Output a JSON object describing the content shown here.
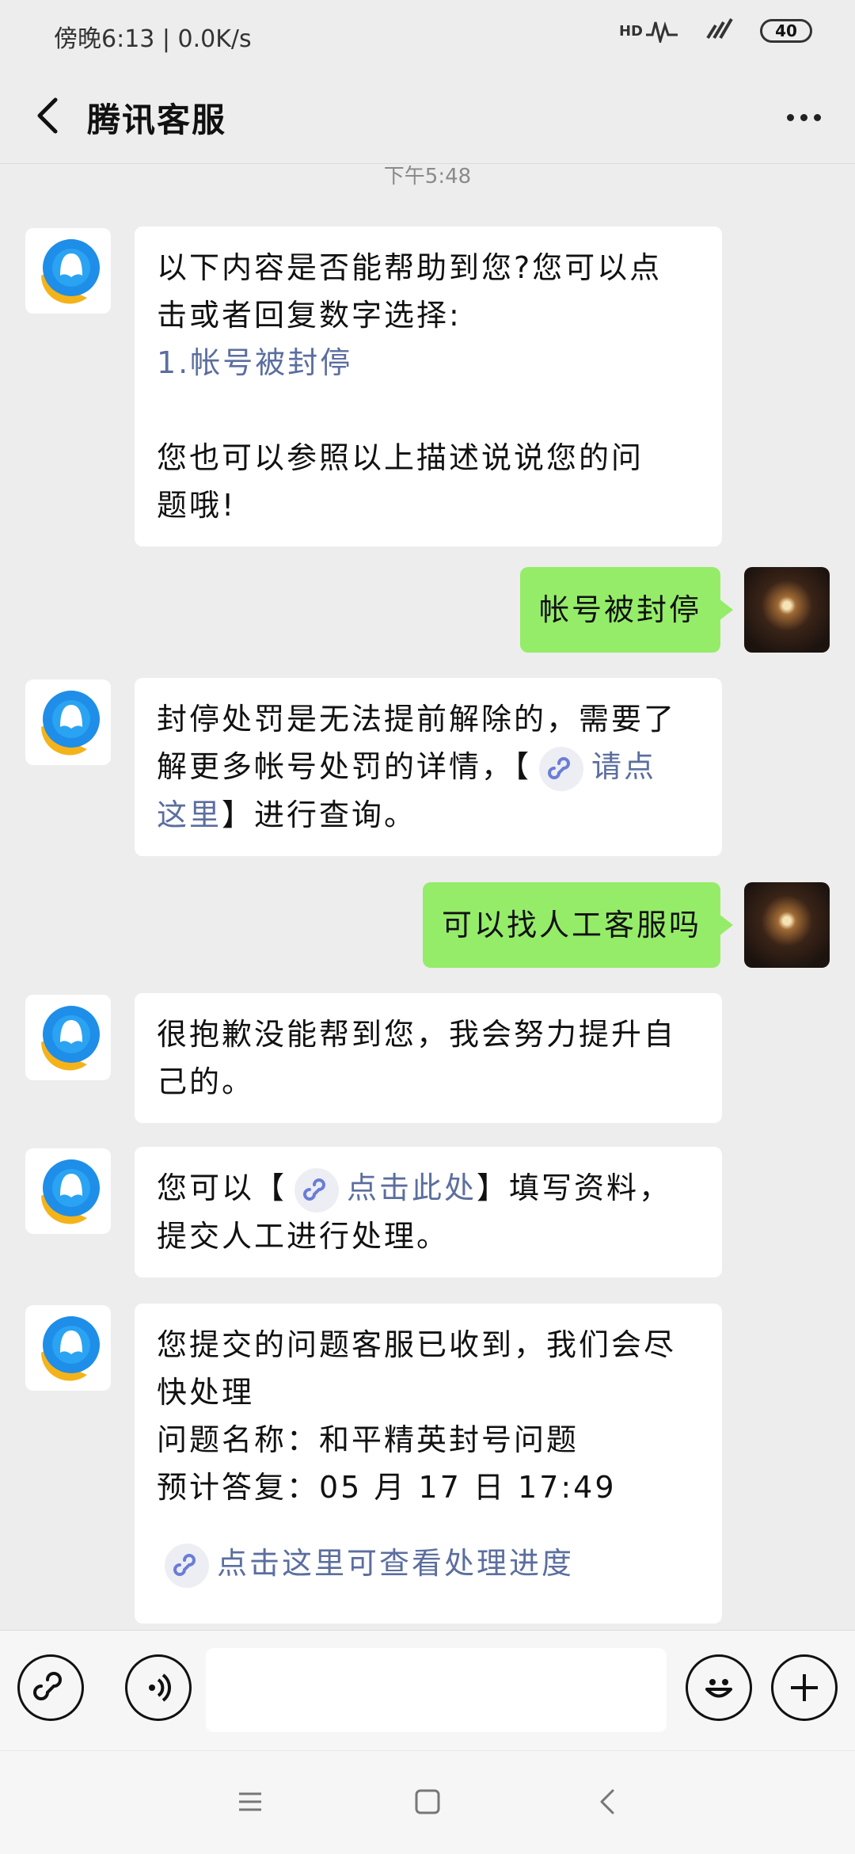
{
  "status_bar": {
    "left_text": "傍晚6:13 | 0.0K/s",
    "hd_label": "HD",
    "battery": "40"
  },
  "header": {
    "title": "腾讯客服"
  },
  "chat": {
    "timestamp": "下午5:48",
    "msg1": {
      "line1": "以下内容是否能帮助到您?您可以点",
      "line2": "击或者回复数字选择:",
      "option": "1.帐号被封停",
      "line4": "您也可以参照以上描述说说您的问",
      "line5": "题哦!"
    },
    "msg2": {
      "text": "帐号被封停"
    },
    "msg3": {
      "line1": "封停处罚是无法提前解除的，需要了",
      "line2_prefix": "解更多帐号处罚的详情，【",
      "link": "请点",
      "link_cont": "这里",
      "suffix": "】进行查询。"
    },
    "msg4": {
      "text": "可以找人工客服吗"
    },
    "msg5": {
      "line1": "很抱歉没能帮到您，我会努力提升自",
      "line2": "己的。"
    },
    "msg6": {
      "prefix": "您可以【",
      "link": "点击此处",
      "suffix": "】填写资料，",
      "line2": "提交人工进行处理。"
    },
    "msg7": {
      "line1": "您提交的问题客服已收到，我们会尽",
      "line2": "快处理",
      "line3": "问题名称：和平精英封号问题",
      "line4": "预计答复：05 月 17 日 17:49",
      "link": "点击这里可查看处理进度"
    }
  },
  "icons": {
    "back": "chevron-left-icon",
    "more": "more-dots-icon",
    "bot_avatar": "qq-logo-icon",
    "mini_program": "link-chain-icon",
    "voice": "voice-icon",
    "emoji": "emoji-icon",
    "add": "plus-icon"
  },
  "colors": {
    "background": "#ededed",
    "self_bubble": "#95ec69",
    "link": "#5b6e9f",
    "qq_blue": "#1e8ee8",
    "qq_yellow": "#f5b31a"
  }
}
